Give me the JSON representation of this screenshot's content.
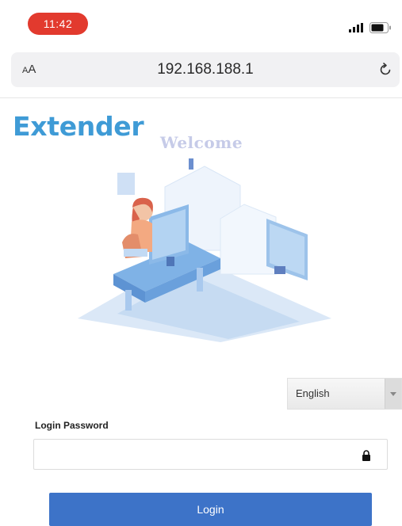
{
  "status_bar": {
    "time": "11:42",
    "signal_icon": "signal-bars-icon",
    "battery_icon": "battery-icon",
    "time_pill_color": "#e23a2e"
  },
  "browser": {
    "text_size_label": "AA",
    "url": "192.168.188.1",
    "reload_icon": "reload-icon"
  },
  "page": {
    "brand": "Extender",
    "welcome": "Welcome",
    "brand_color": "#3f9bd6",
    "illustration_icon": "workspace-illustration"
  },
  "language": {
    "selected": "English"
  },
  "login": {
    "password_label": "Login Password",
    "password_value": "",
    "lock_icon": "lock-icon",
    "button_label": "Login",
    "button_color": "#3d73c8"
  }
}
